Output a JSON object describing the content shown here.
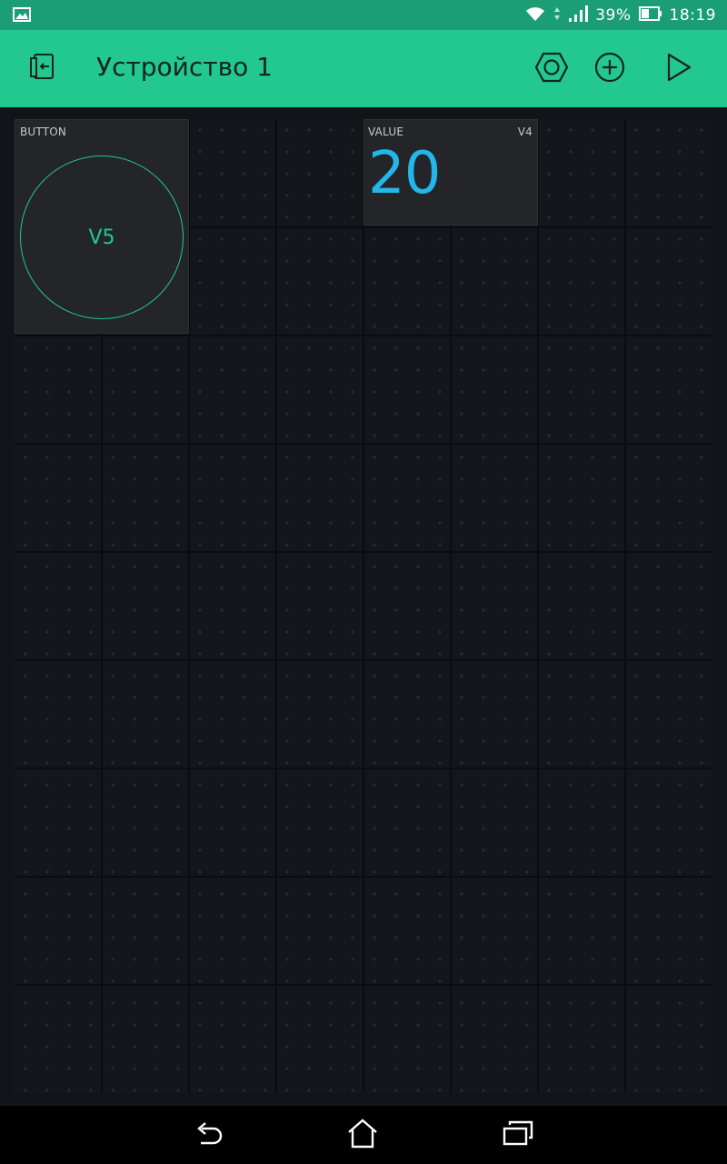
{
  "status_bar": {
    "gallery_icon": "image-icon",
    "wifi_icon": "wifi-icon",
    "signal_icon": "signal-icon",
    "battery_percent": "39%",
    "battery_icon": "battery-icon",
    "time": "18:19",
    "color": "#1c9e74"
  },
  "toolbar": {
    "title": "Устройство 1",
    "device_icon": "device-switch-icon",
    "settings_icon": "hexagon-nut-icon",
    "add_icon": "plus-circle-icon",
    "play_icon": "play-icon",
    "color": "#23c890"
  },
  "widgets": {
    "button": {
      "label": "BUTTON",
      "pin": "V5",
      "color": "#23c890"
    },
    "value": {
      "label": "VALUE",
      "pin": "V4",
      "value": "20",
      "color": "#23b6e9"
    }
  },
  "nav_bar": {
    "back_icon": "back-icon",
    "home_icon": "home-icon",
    "recents_icon": "recents-icon"
  }
}
